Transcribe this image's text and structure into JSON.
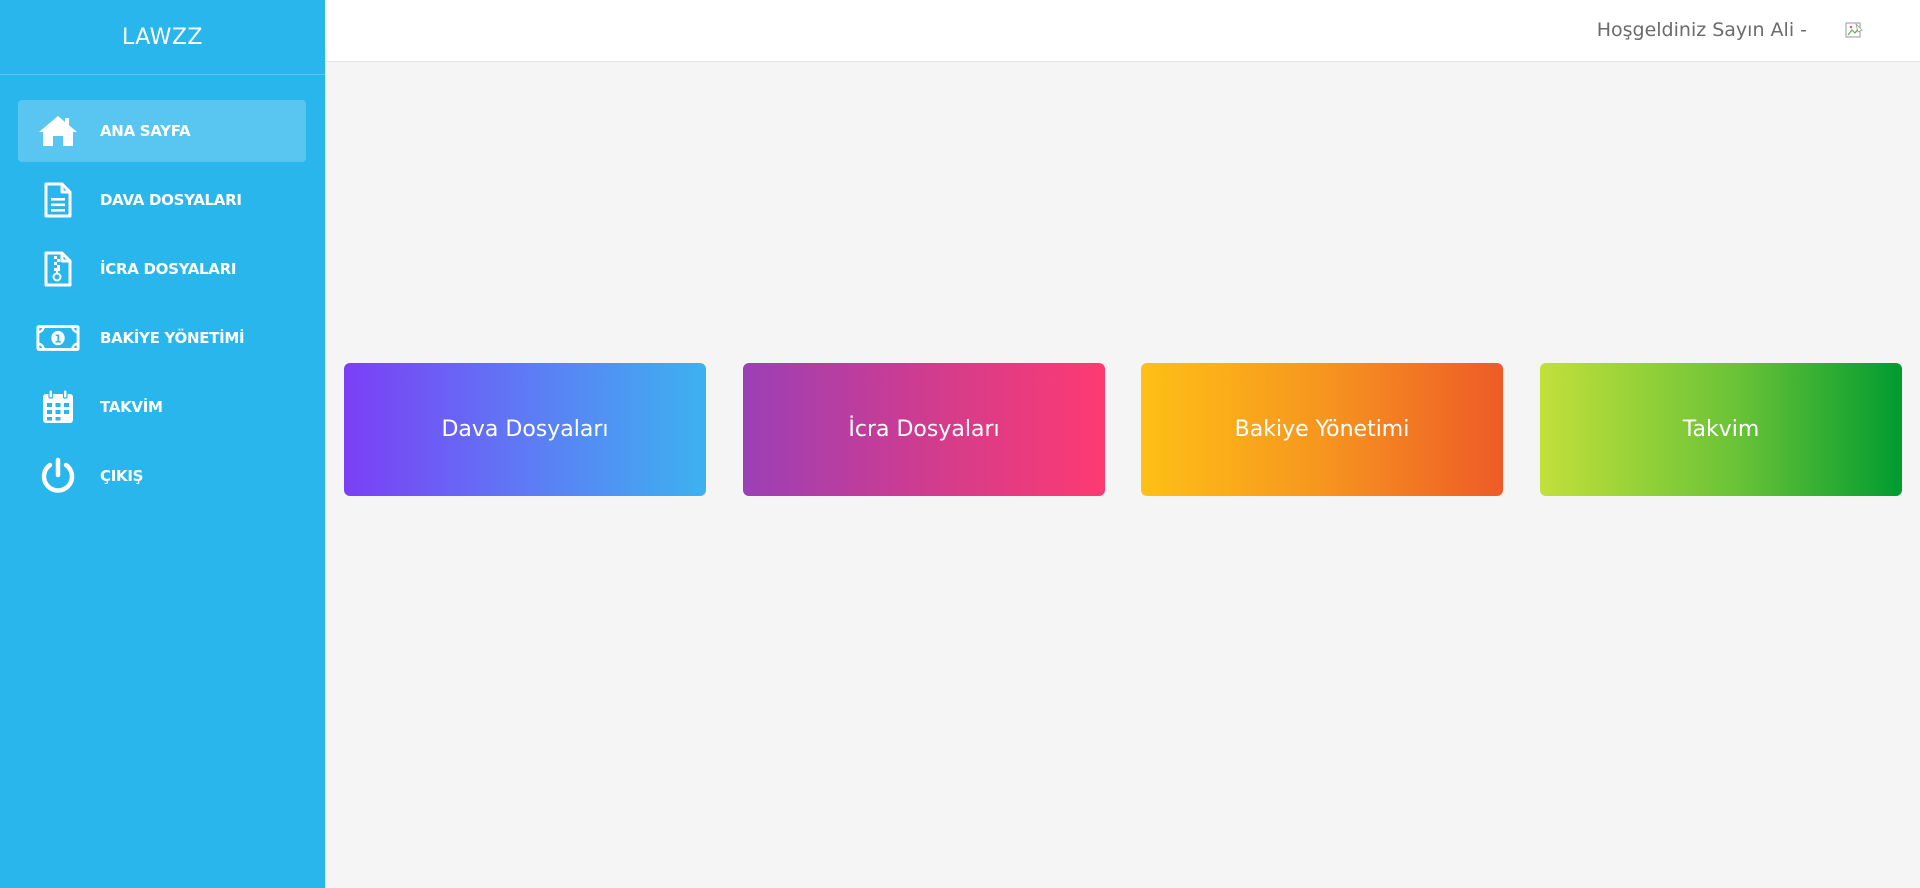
{
  "brand": "LAWZZ",
  "sidebar": {
    "items": [
      {
        "label": "ANA SAYFA",
        "icon": "home-icon",
        "active": true
      },
      {
        "label": "DAVA DOSYALARI",
        "icon": "document-icon",
        "active": false
      },
      {
        "label": "İCRA DOSYALARI",
        "icon": "zip-file-icon",
        "active": false
      },
      {
        "label": "BAKİYE YÖNETİMİ",
        "icon": "money-icon",
        "active": false
      },
      {
        "label": "TAKVİM",
        "icon": "calendar-icon",
        "active": false
      },
      {
        "label": "ÇIKIŞ",
        "icon": "power-icon",
        "active": false
      }
    ]
  },
  "header": {
    "welcome": "Hoşgeldiniz Sayın Ali -",
    "avatar_icon": "broken-image-icon"
  },
  "cards": [
    {
      "label": "Dava Dosyaları",
      "colors": [
        "#7b3ff5",
        "#3cb2f0"
      ]
    },
    {
      "label": "İcra Dosyaları",
      "colors": [
        "#9c3fb6",
        "#fe3a72"
      ]
    },
    {
      "label": "Bakiye Yönetimi",
      "colors": [
        "#fec016",
        "#ee5a27"
      ]
    },
    {
      "label": "Takvim",
      "colors": [
        "#c2e03a",
        "#009b30"
      ]
    }
  ],
  "colors": {
    "sidebar": "#29b6ec",
    "background": "#f5f5f5",
    "header": "#ffffff"
  }
}
